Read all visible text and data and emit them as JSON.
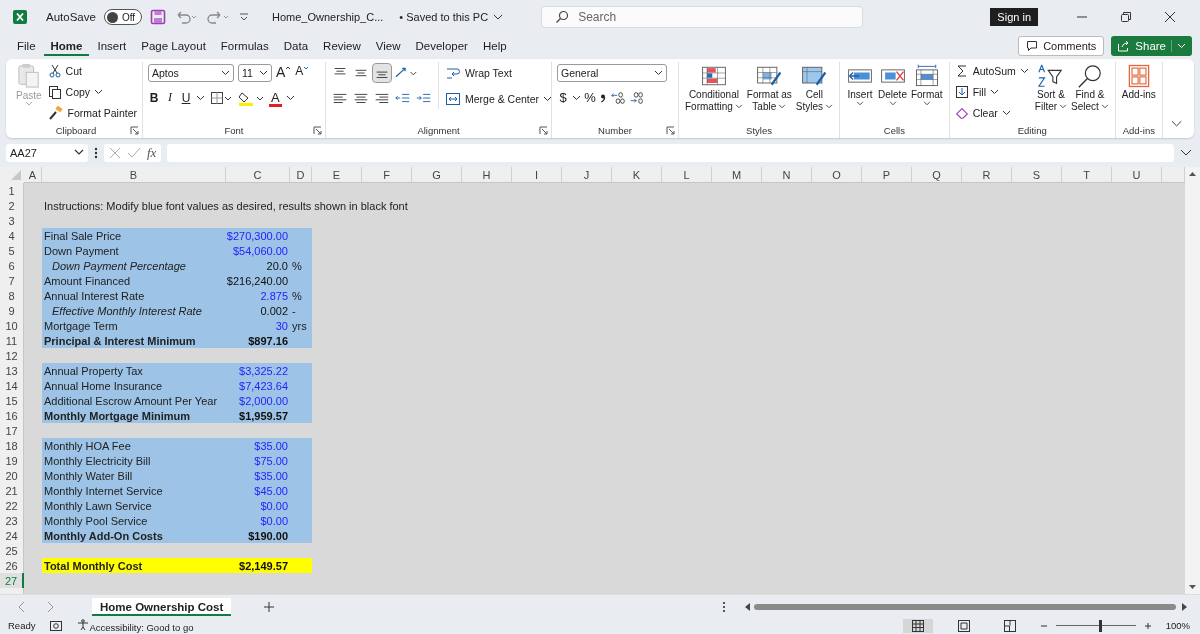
{
  "titlebar": {
    "autosave_label": "AutoSave",
    "autosave": {
      "on": false,
      "label": "Off"
    },
    "filename": "Home_Ownership_C...",
    "save_status": "• Saved to this PC",
    "search": {
      "placeholder": "Search"
    },
    "sign_in": "Sign in"
  },
  "menu": {
    "tabs": [
      {
        "label": "File",
        "selected": false
      },
      {
        "label": "Home",
        "selected": true
      },
      {
        "label": "Insert",
        "selected": false
      },
      {
        "label": "Page Layout",
        "selected": false
      },
      {
        "label": "Formulas",
        "selected": false
      },
      {
        "label": "Data",
        "selected": false
      },
      {
        "label": "Review",
        "selected": false
      },
      {
        "label": "View",
        "selected": false
      },
      {
        "label": "Developer",
        "selected": false
      },
      {
        "label": "Help",
        "selected": false
      }
    ],
    "comments": "Comments",
    "share": "Share"
  },
  "ribbon": {
    "groups": [
      {
        "kind": "clipboard",
        "name": "Clipboard",
        "paste": {
          "label": "Paste",
          "disabled": true
        },
        "items": [
          {
            "kind": "cut",
            "label": "Cut"
          },
          {
            "kind": "copy",
            "label": "Copy"
          },
          {
            "kind": "painter",
            "label": "Format Painter"
          }
        ]
      },
      {
        "kind": "font",
        "name": "Font",
        "font": "Aptos",
        "size": "11",
        "grow": "A",
        "shrink": "A",
        "styles": [
          {
            "kind": "bold",
            "label": "B"
          },
          {
            "kind": "italic",
            "label": "I"
          },
          {
            "kind": "underline",
            "label": "U"
          }
        ],
        "font_color": "A"
      },
      {
        "kind": "alignment",
        "name": "Alignment",
        "valign": [
          {
            "selected": false
          },
          {
            "selected": false
          },
          {
            "selected": true
          }
        ],
        "wrap": "Wrap Text",
        "merge": "Merge & Center"
      },
      {
        "kind": "number",
        "name": "Number",
        "format": "General",
        "currency": "$",
        "percent": "%"
      },
      {
        "kind": "large",
        "name": "Styles",
        "buttons": [
          {
            "kind": "conditional",
            "lines": [
              "Conditional",
              "Formatting"
            ]
          },
          {
            "kind": "table",
            "lines": [
              "Format as",
              "Table"
            ]
          },
          {
            "kind": "cellstyles",
            "lines": [
              "Cell",
              "Styles"
            ]
          }
        ]
      },
      {
        "kind": "large",
        "name": "Cells",
        "buttons": [
          {
            "kind": "insert",
            "lines": [
              "Insert"
            ]
          },
          {
            "kind": "delete",
            "lines": [
              "Delete"
            ]
          },
          {
            "kind": "format",
            "lines": [
              "Format"
            ]
          }
        ]
      },
      {
        "kind": "editing",
        "name": "Editing",
        "small": [
          {
            "kind": "autosum",
            "label": "AutoSum"
          },
          {
            "kind": "fill",
            "label": "Fill"
          },
          {
            "kind": "clear",
            "label": "Clear"
          }
        ],
        "buttons": [
          {
            "kind": "sort",
            "lines": [
              "Sort &",
              "Filter"
            ]
          },
          {
            "kind": "find",
            "lines": [
              "Find &",
              "Select"
            ]
          }
        ]
      },
      {
        "kind": "large",
        "name": "Add-ins",
        "buttons": [
          {
            "kind": "addins",
            "lines": [
              "Add-ins"
            ]
          }
        ]
      }
    ]
  },
  "formula_bar": {
    "name_box": "AA27",
    "function_label": "fx"
  },
  "sheet": {
    "columns": [
      "A",
      "B",
      "C",
      "D",
      "E",
      "F",
      "G",
      "H",
      "I",
      "J",
      "K",
      "L",
      "M",
      "N",
      "O",
      "P",
      "Q",
      "R",
      "S",
      "T",
      "U"
    ],
    "rows": [
      {
        "header": "1",
        "selected": false
      },
      {
        "header": "2",
        "selected": false,
        "note": "Instructions: Modify blue font values as desired, results shown in black font"
      },
      {
        "header": "3",
        "selected": false
      },
      {
        "header": "4",
        "selected": false,
        "color": "#9dc3e6",
        "label": "Final Sale Price",
        "value": "$270,300.00",
        "kind": "input"
      },
      {
        "header": "5",
        "selected": false,
        "color": "#9dc3e6",
        "label": "Down Payment",
        "value": "$54,060.00",
        "kind": "input"
      },
      {
        "header": "6",
        "selected": false,
        "color": "#9dc3e6",
        "label": "Down Payment Percentage",
        "value": "20.0",
        "unit": "%",
        "kind": "derived"
      },
      {
        "header": "7",
        "selected": false,
        "color": "#9dc3e6",
        "label": "Amount Financed",
        "value": "$216,240.00",
        "kind": "result"
      },
      {
        "header": "8",
        "selected": false,
        "color": "#9dc3e6",
        "label": "Annual Interest Rate",
        "value": "2.875",
        "unit": "%",
        "kind": "input"
      },
      {
        "header": "9",
        "selected": false,
        "color": "#9dc3e6",
        "label": "Effective Monthly Interest Rate",
        "value": "0.002",
        "unit": "-",
        "kind": "derived"
      },
      {
        "header": "10",
        "selected": false,
        "color": "#9dc3e6",
        "label": "Mortgage Term",
        "value": "30",
        "unit": "yrs",
        "kind": "input"
      },
      {
        "header": "11",
        "selected": false,
        "color": "#9dc3e6",
        "label": "Principal & Interest Minimum",
        "value": "$897.16",
        "kind": "total"
      },
      {
        "header": "12",
        "selected": false
      },
      {
        "header": "13",
        "selected": false,
        "color": "#9dc3e6",
        "label": "Annual Property Tax",
        "value": "$3,325.22",
        "kind": "input"
      },
      {
        "header": "14",
        "selected": false,
        "color": "#9dc3e6",
        "label": "Annual Home Insurance",
        "value": "$7,423.64",
        "kind": "input"
      },
      {
        "header": "15",
        "selected": false,
        "color": "#9dc3e6",
        "label": "Additional Escrow Amount Per Year",
        "value": "$2,000.00",
        "kind": "input"
      },
      {
        "header": "16",
        "selected": false,
        "color": "#9dc3e6",
        "label": "Monthly Mortgage Minimum",
        "value": "$1,959.57",
        "kind": "total"
      },
      {
        "header": "17",
        "selected": false
      },
      {
        "header": "18",
        "selected": false,
        "color": "#9dc3e6",
        "label": "Monthly HOA Fee",
        "value": "$35.00",
        "kind": "input"
      },
      {
        "header": "19",
        "selected": false,
        "color": "#9dc3e6",
        "label": "Monthly Electricity Bill",
        "value": "$75.00",
        "kind": "input"
      },
      {
        "header": "20",
        "selected": false,
        "color": "#9dc3e6",
        "label": "Monthly Water Bill",
        "value": "$35.00",
        "kind": "input"
      },
      {
        "header": "21",
        "selected": false,
        "color": "#9dc3e6",
        "label": "Monthly Internet Service",
        "value": "$45.00",
        "kind": "input"
      },
      {
        "header": "22",
        "selected": false,
        "color": "#9dc3e6",
        "label": "Monthly Lawn Service",
        "value": "$0.00",
        "kind": "input"
      },
      {
        "header": "23",
        "selected": false,
        "color": "#9dc3e6",
        "label": "Monthly Pool Service",
        "value": "$0.00",
        "kind": "input"
      },
      {
        "header": "24",
        "selected": false,
        "color": "#9dc3e6",
        "label": "Monthly Add-On Costs",
        "value": "$190.00",
        "kind": "total"
      },
      {
        "header": "25",
        "selected": false
      },
      {
        "header": "26",
        "selected": false,
        "color": "#ffff00",
        "label": "Total Monthly Cost",
        "value": "$2,149.57",
        "kind": "total"
      },
      {
        "header": "27",
        "selected": true
      }
    ]
  },
  "sheet_tabs": [
    {
      "label": "Home Ownership Cost",
      "selected": true
    }
  ],
  "status_bar": {
    "ready": "Ready",
    "accessibility": "Accessibility: Good to go",
    "views": [
      {
        "selected": true
      },
      {
        "selected": false
      },
      {
        "selected": false
      }
    ],
    "zoom": {
      "level": 0.55,
      "reading": "100%"
    }
  }
}
